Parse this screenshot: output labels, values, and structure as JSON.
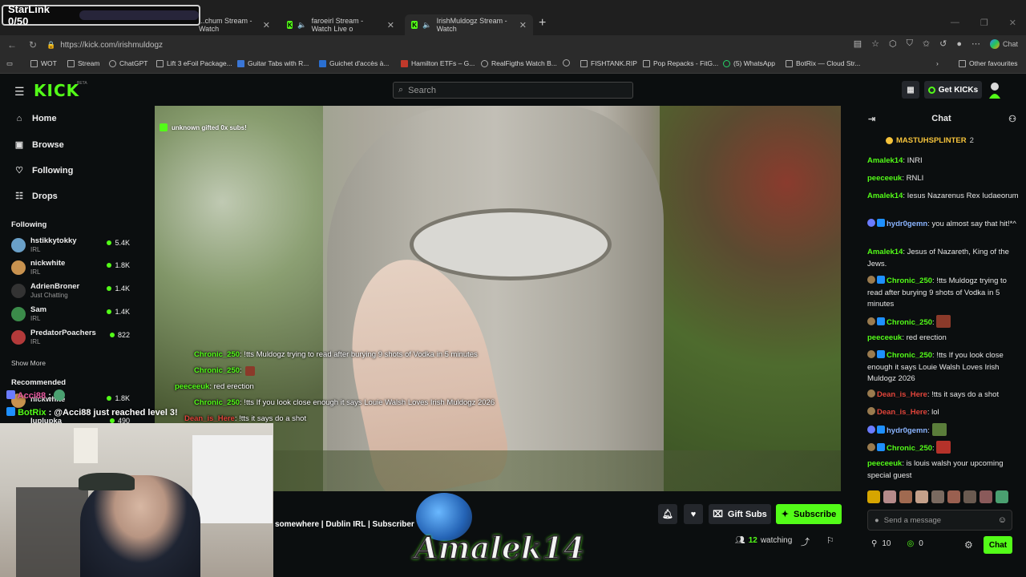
{
  "browser": {
    "tabs": [
      {
        "label": "...chum Stream - Watch",
        "active": false
      },
      {
        "label": "faroeirl Stream - Watch Live o",
        "active": false
      },
      {
        "label": "IrishMuldogz Stream - Watch",
        "active": true
      }
    ],
    "url": "https://kick.com/irishmuldogz",
    "copilot_label": "Chat",
    "bookmarks": [
      "WOT",
      "Stream",
      "ChatGPT",
      "Lift 3 eFoil Package...",
      "Guitar Tabs with R...",
      "Guichet d'accès à...",
      "Hamilton ETFs – G...",
      "RealFigths Watch B...",
      "FISHTANK.RIP",
      "Pop Repacks - FitG...",
      "(5) WhatsApp",
      "BotRix — Cloud Str..."
    ],
    "other_favourites": "Other favourites"
  },
  "overlay": {
    "starlink": "StarLink 0/50",
    "bot_line1_user": "Acci88",
    "bot_line1_suffix": ":",
    "bot_line2_user": "BotRix",
    "bot_line2_text": ": @Acci88 just reached level 3!"
  },
  "header": {
    "logo": "KICK",
    "beta": "BETA",
    "search_placeholder": "Search",
    "get_kicks": "Get KICKs"
  },
  "sidebar": {
    "nav": [
      "Home",
      "Browse",
      "Following",
      "Drops"
    ],
    "following_title": "Following",
    "following": [
      {
        "name": "hstikkytokky",
        "category": "IRL",
        "viewers": "5.4K",
        "color": "#6aa0c8"
      },
      {
        "name": "nickwhite",
        "category": "IRL",
        "viewers": "1.8K",
        "color": "#c8924f"
      },
      {
        "name": "AdrienBroner",
        "category": "Just Chatting",
        "viewers": "1.4K",
        "color": "#333333"
      },
      {
        "name": "Sam",
        "category": "IRL",
        "viewers": "1.4K",
        "color": "#3b8b4a"
      },
      {
        "name": "PredatorPoachers",
        "category": "IRL",
        "viewers": "822",
        "color": "#b33a3a"
      }
    ],
    "show_more": "Show More",
    "recommended_title": "Recommended",
    "recommended": [
      {
        "name": "nickwhite",
        "viewers": "1.8K"
      },
      {
        "name": "luplupka",
        "viewers": "490"
      }
    ]
  },
  "video": {
    "gift_notice": "unknown gifted 0x subs!",
    "overlay_chat": [
      {
        "user": "Chronic_250",
        "text": ": !tts Muldogz trying to read after burying 9 shots of Vodka in 5 minutes",
        "color": "green"
      },
      {
        "user": "Chronic_250",
        "text": ":",
        "color": "green"
      },
      {
        "user": "peeceeuk",
        "text": ": red erection",
        "color": "green"
      },
      {
        "user": "Chronic_250",
        "text": ": !tts If you look close enough it says Louie Walsh Loves Irish Muldogz 2026",
        "color": "green"
      },
      {
        "user": "Dean_is_Here",
        "text": ": !tts it says do a shot",
        "color": "red"
      }
    ]
  },
  "stream_bar": {
    "tagline": "somewhere | Dublin IRL | Subscriber TT",
    "logo_text": "Amalek14",
    "gift_subs": "Gift Subs",
    "subscribe": "Subscribe",
    "watching_count": "12",
    "watching_label": "watching"
  },
  "chat": {
    "title": "Chat",
    "pinned_user": "MASTUHSPLINTER",
    "pinned_count": "2",
    "messages": [
      {
        "user": "Amalek14",
        "text": ": INRI",
        "color": "green",
        "badges": []
      },
      {
        "user": "peeceeuk",
        "text": ": RNLI",
        "color": "green",
        "badges": []
      },
      {
        "user": "Amalek14",
        "text": ": Iesus Nazarenus Rex Iudaeorum",
        "color": "green",
        "badges": []
      },
      {
        "user": "hydr0gemn",
        "text": ": you almost say that hit!*^",
        "color": "blue",
        "badges": [
          "b3",
          "b2"
        ]
      },
      {
        "user": "Amalek14",
        "text": ": Jesus of Nazareth, King of the Jews.",
        "color": "green",
        "badges": []
      },
      {
        "user": "Chronic_250",
        "text": ": !tts Muldogz trying to read after burying 9 shots of Vodka in 5 minutes",
        "color": "green",
        "badges": [
          "b1",
          "b2"
        ]
      },
      {
        "user": "Chronic_250",
        "text": ":",
        "color": "green",
        "badges": [
          "b1",
          "b2"
        ],
        "emote": true
      },
      {
        "user": "peeceeuk",
        "text": ": red erection",
        "color": "green",
        "badges": []
      },
      {
        "user": "Chronic_250",
        "text": ": !tts If you look close enough it says Louie Walsh Loves Irish Muldogz 2026",
        "color": "green",
        "badges": [
          "b1",
          "b2"
        ]
      },
      {
        "user": "Dean_is_Here",
        "text": ": !tts it says do a shot",
        "color": "red",
        "badges": [
          "b1"
        ]
      },
      {
        "user": "Dean_is_Here",
        "text": ": lol",
        "color": "red",
        "badges": [
          "b1"
        ]
      },
      {
        "user": "hydr0gemn",
        "text": ":",
        "color": "blue",
        "badges": [
          "b3",
          "b2"
        ],
        "emote": true
      },
      {
        "user": "Chronic_250",
        "text": ":",
        "color": "green",
        "badges": [
          "b1",
          "b2"
        ],
        "emote": true
      },
      {
        "user": "peeceeuk",
        "text": ": is louis walsh your upcoming special guest",
        "color": "green",
        "badges": []
      }
    ],
    "send_placeholder": "Send a message",
    "kicks_count": "10",
    "points_count": "0",
    "chat_button": "Chat"
  }
}
